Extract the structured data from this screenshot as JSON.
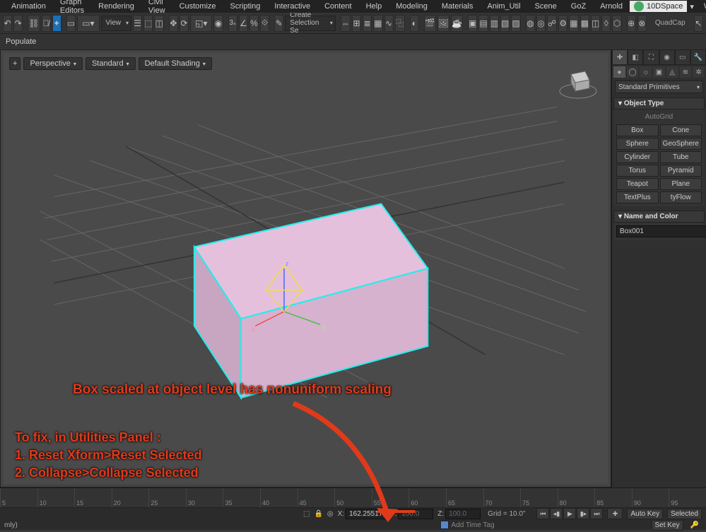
{
  "menu": {
    "items": [
      "Animation",
      "Graph Editors",
      "Rendering",
      "Civil View",
      "Customize",
      "Scripting",
      "Interactive",
      "Content",
      "Help",
      "Modeling",
      "Materials",
      "Anim_Util",
      "Scene",
      "GoZ",
      "Arnold"
    ],
    "workspace": "10DSpace",
    "workspace_right": "Work"
  },
  "toolbar": {
    "dropdown_view": "View",
    "dropdown_create_sel": "Create Selection Se",
    "quadcap": "QuadCap",
    "populate": "Populate"
  },
  "viewport": {
    "plus": "+",
    "persp": "Perspective",
    "shading": "Standard",
    "mode": "Default Shading"
  },
  "panel": {
    "category": "Standard Primitives",
    "rollout_objtype": "Object Type",
    "autogrid": "AutoGrid",
    "prims": [
      [
        "Box",
        "Cone"
      ],
      [
        "Sphere",
        "GeoSphere"
      ],
      [
        "Cylinder",
        "Tube"
      ],
      [
        "Torus",
        "Pyramid"
      ],
      [
        "Teapot",
        "Plane"
      ],
      [
        "TextPlus",
        "tyFlow"
      ]
    ],
    "rollout_name": "Name and Color",
    "object_name": "Box001"
  },
  "annotation": {
    "headline": "Box scaled at object level has nonuniform scaling",
    "fix_title": "To fix, in Utilities Panel :",
    "step1": "1.  Reset Xform>Reset Selected",
    "step2": "2. Collapse>Collapse Selected"
  },
  "timeline": {
    "ticks": [
      "5",
      "10",
      "15",
      "20",
      "25",
      "30",
      "35",
      "40",
      "45",
      "50",
      "55",
      "60",
      "65",
      "70",
      "75",
      "80",
      "85",
      "90",
      "95"
    ]
  },
  "status": {
    "x_label": "X:",
    "x_value": "162.25517",
    "y_label": "Y:",
    "y_value": "100.0",
    "z_label": "Z:",
    "z_value": "100.0",
    "grid": "Grid = 10.0\"",
    "autokey": "Auto Key",
    "setkey": "Set Key",
    "selected": "Selected",
    "mly": "mly)",
    "add_time_tag": "Add Time Tag"
  }
}
